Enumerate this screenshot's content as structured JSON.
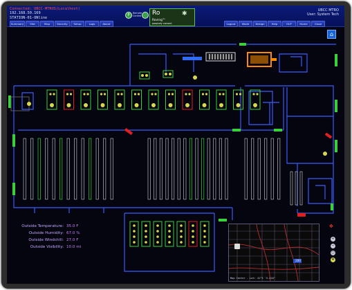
{
  "connection": {
    "line1": "Connected: UBCC-MTROS(Localhost)",
    "line2": "192.168.50.169",
    "line3": "STATION-01-ONline"
  },
  "status_icons": [
    {
      "letter": "P",
      "label": "Remote Control",
      "color": "#3aa24a"
    },
    {
      "letter": "",
      "label": "",
      "color": "#3aa24a"
    }
  ],
  "ro_card": {
    "code": "Ro",
    "name": "Roving™",
    "sub": "passively connect"
  },
  "site": {
    "name": "UBCC MTRO",
    "user": "User: System Tech"
  },
  "tabs_left": [
    "Summary",
    "Site",
    "Map",
    "Security",
    "Setup",
    "Logs",
    "About"
  ],
  "tabs_right": [
    "Logout",
    "Mode",
    "Design",
    "Help",
    "OUT",
    "Home",
    "Close"
  ],
  "weather": [
    {
      "label": "Outside Temperature:",
      "value": "35.0 F"
    },
    {
      "label": "Outside Humidity:",
      "value": "67.0 %"
    },
    {
      "label": "Outside Windchill:",
      "value": "27.0 F"
    },
    {
      "label": "Outside Visibility:",
      "value": "10.0 mi"
    }
  ],
  "map": {
    "center": "Map Center - Lat: 41°3 '5.410\"",
    "badge": "200"
  },
  "dock_doors": [
    {
      "state": "ok"
    },
    {
      "state": "alarm"
    },
    {
      "state": "ok"
    },
    {
      "state": "ok"
    },
    {
      "state": "ok"
    },
    {
      "state": "ok"
    },
    {
      "state": "ok"
    },
    {
      "state": "ok"
    },
    {
      "state": "alarm"
    },
    {
      "state": "ok"
    },
    {
      "state": "ok"
    },
    {
      "state": "ok"
    },
    {
      "state": "ok"
    }
  ],
  "bottom_docks": [
    {
      "state": "ok"
    },
    {
      "state": "ok"
    },
    {
      "state": "ok"
    },
    {
      "state": "ok"
    },
    {
      "state": "ok"
    },
    {
      "state": "alarm"
    },
    {
      "state": "ok"
    }
  ],
  "colors": {
    "ok": "#39d13c",
    "alarm": "#e02020",
    "wall": "#3a5cff",
    "light": "#d8d850",
    "accent": "#ff8a00"
  }
}
